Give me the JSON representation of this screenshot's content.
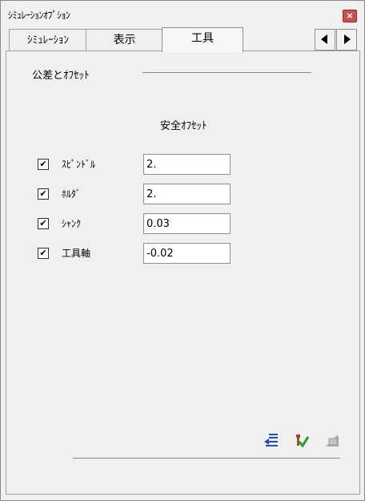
{
  "window": {
    "title": "ｼﾐｭﾚｰｼｮﾝｵﾌﾟｼｮﾝ",
    "close_symbol": "×"
  },
  "tabs": [
    {
      "label": "ｼﾐｭﾚｰｼｮﾝ"
    },
    {
      "label": "表示"
    },
    {
      "label": "工具"
    }
  ],
  "tab_scroll": {
    "left_icon": "scroll-left-icon",
    "right_icon": "scroll-right-icon"
  },
  "group": {
    "title": "公差とｵﾌｾｯﾄ"
  },
  "safety": {
    "title": "安全ｵﾌｾｯﾄ",
    "rows": [
      {
        "label": "ｽﾋﾟﾝﾄﾞﾙ",
        "checked": true,
        "value": "2."
      },
      {
        "label": "ﾎﾙﾀﾞ",
        "checked": true,
        "value": "2."
      },
      {
        "label": "ｼｬﾝｸ",
        "checked": true,
        "value": "0.03"
      },
      {
        "label": "工具軸",
        "checked": true,
        "value": "-0.02"
      }
    ],
    "check_mark": "✔"
  },
  "footer_icons": [
    "import-list-icon",
    "apply-check-icon",
    "disabled-action-icon"
  ],
  "colors": {
    "background": "#f0f0f0",
    "close": "#c75050",
    "icon_blue": "#1f4fb8",
    "icon_green": "#2e9a2e"
  }
}
